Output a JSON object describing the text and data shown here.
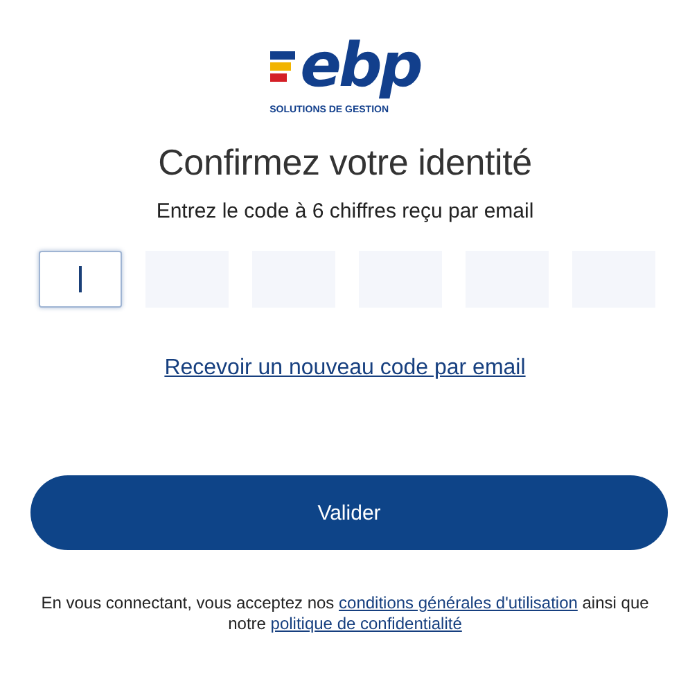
{
  "logo": {
    "wordmark": "ebp",
    "tagline": "SOLUTIONS DE GESTION"
  },
  "title": "Confirmez votre identité",
  "instruction": "Entrez le code à 6 chiffres reçu par email",
  "code_inputs": [
    {
      "focused": true
    },
    {
      "focused": false
    },
    {
      "focused": false
    },
    {
      "focused": false
    },
    {
      "focused": false
    },
    {
      "focused": false
    }
  ],
  "resend_link": "Recevoir un nouveau code par email",
  "submit_button": "Valider",
  "legal": {
    "text_before": "En vous connectant, vous acceptez nos ",
    "terms_link": "conditions générales d'utilisation",
    "text_middle": " ainsi que notre ",
    "privacy_link": "politique de confidentialité"
  }
}
